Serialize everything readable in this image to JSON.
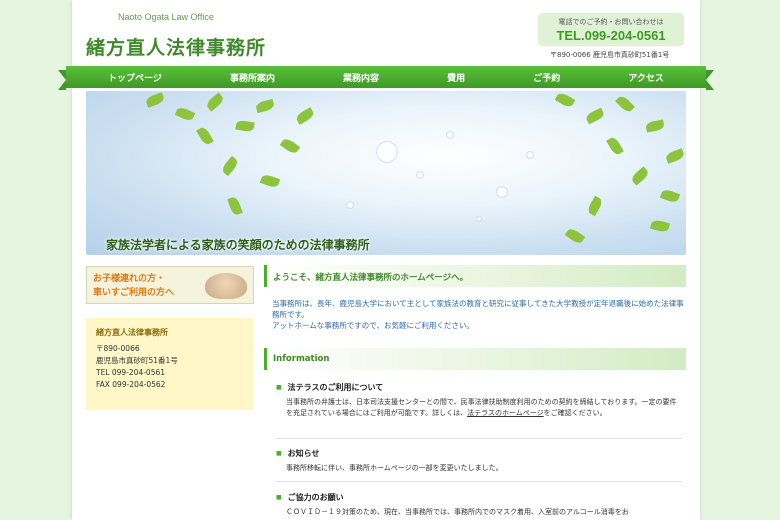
{
  "header": {
    "brand_en": "Naoto Ogata Law Office",
    "brand_jp": "緒方直人法律事務所",
    "contact_label": "電話でのご予約・お問い合わせは",
    "contact_tel": "TEL.099-204-0561",
    "address": "〒890-0066 鹿児島市真砂町51番1号"
  },
  "nav": [
    "トップページ",
    "事務所案内",
    "業務内容",
    "費用",
    "ご予約",
    "アクセス"
  ],
  "hero": {
    "caption": "家族法学者による家族の笑顔のための法律事務所"
  },
  "sidebar": {
    "banner_line1": "お子様連れの方・",
    "banner_line2": "車いすご利用の方へ",
    "office_name": "緒方直人法律事務所",
    "office_postcode": "〒890-0066",
    "office_address": "鹿児島市真砂町51番1号",
    "office_tel": "TEL 099-204-0561",
    "office_fax": "FAX 099-204-0562"
  },
  "main": {
    "welcome_title": "ようこそ、緒方直人法律事務所のホームページへ。",
    "welcome_p1": "当事務所は、長年、鹿児島大学において主として家族法の教育と研究に従事してきた大学教授が定年退職後に始めた法律事務所です。",
    "welcome_p2": "アットホームな事務所ですので、お気軽にご利用ください。",
    "info_title": "Information",
    "items": [
      {
        "title": "法テラスのご利用について",
        "body": "当事務所の弁護士は、日本司法支援センターとの間で、民事法律扶助制度利用のための契約を締結しております。一定の要件を充足されている場合にはご利用が可能です。詳しくは、",
        "link": "法テラスのホームページ",
        "body_tail": "をご確認ください。"
      },
      {
        "title": "お知らせ",
        "body": "事務所移転に伴い、事務所ホームページの一部を変更いたしました。"
      },
      {
        "title": "ご協力のお願い",
        "body": "ＣＯＶＩＤ－１９対策のため、現在、当事務所では、事務所内でのマスク着用、入室前のアルコール消毒をお"
      }
    ]
  },
  "colors": {
    "brand_green": "#3f8a2b",
    "nav_green": "#4caf2c",
    "link_blue": "#2d6aa8",
    "banner_orange": "#e07a13"
  }
}
